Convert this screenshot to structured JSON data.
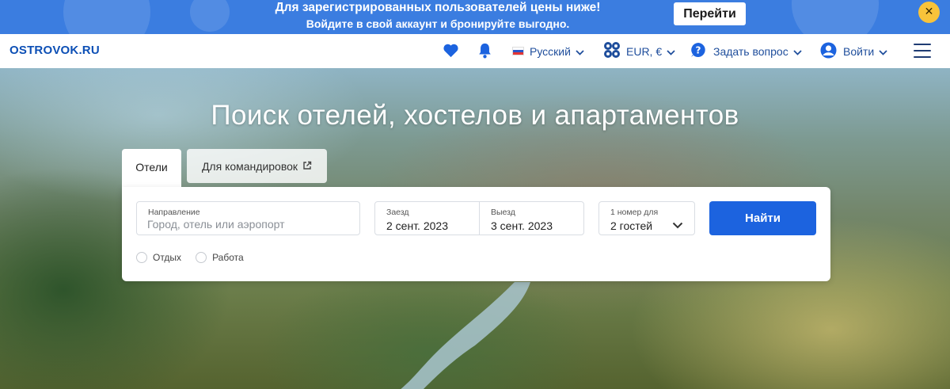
{
  "promo": {
    "line1": "Для зарегистрированных пользователей цены ниже!",
    "line2": "Войдите в свой аккаунт и бронируйте выгодно.",
    "button_label": "Перейти",
    "close_glyph": "✕"
  },
  "header": {
    "logo": "OSTROVOK.RU",
    "language": "Русский",
    "currency": "EUR, €",
    "help": "Задать вопрос",
    "login": "Войти"
  },
  "hero": {
    "title": "Поиск отелей, хостелов и апартаментов"
  },
  "tabs": [
    {
      "label": "Отели",
      "active": true
    },
    {
      "label": "Для командировок",
      "active": false,
      "icon": "external-link-icon"
    }
  ],
  "search": {
    "destination": {
      "label": "Направление",
      "placeholder": "Город, отель или аэропорт"
    },
    "checkin": {
      "label": "Заезд",
      "value": "2 сент. 2023"
    },
    "checkout": {
      "label": "Выезд",
      "value": "3 сент. 2023"
    },
    "guests": {
      "label": "1 номер для",
      "value": "2 гостей"
    },
    "submit_label": "Найти",
    "purpose_options": [
      "Отдых",
      "Работа"
    ]
  },
  "colors": {
    "banner": "#3b7de0",
    "brand": "#0c4fb5",
    "primary_button": "#1c63df",
    "close_button": "#f8c33a"
  }
}
